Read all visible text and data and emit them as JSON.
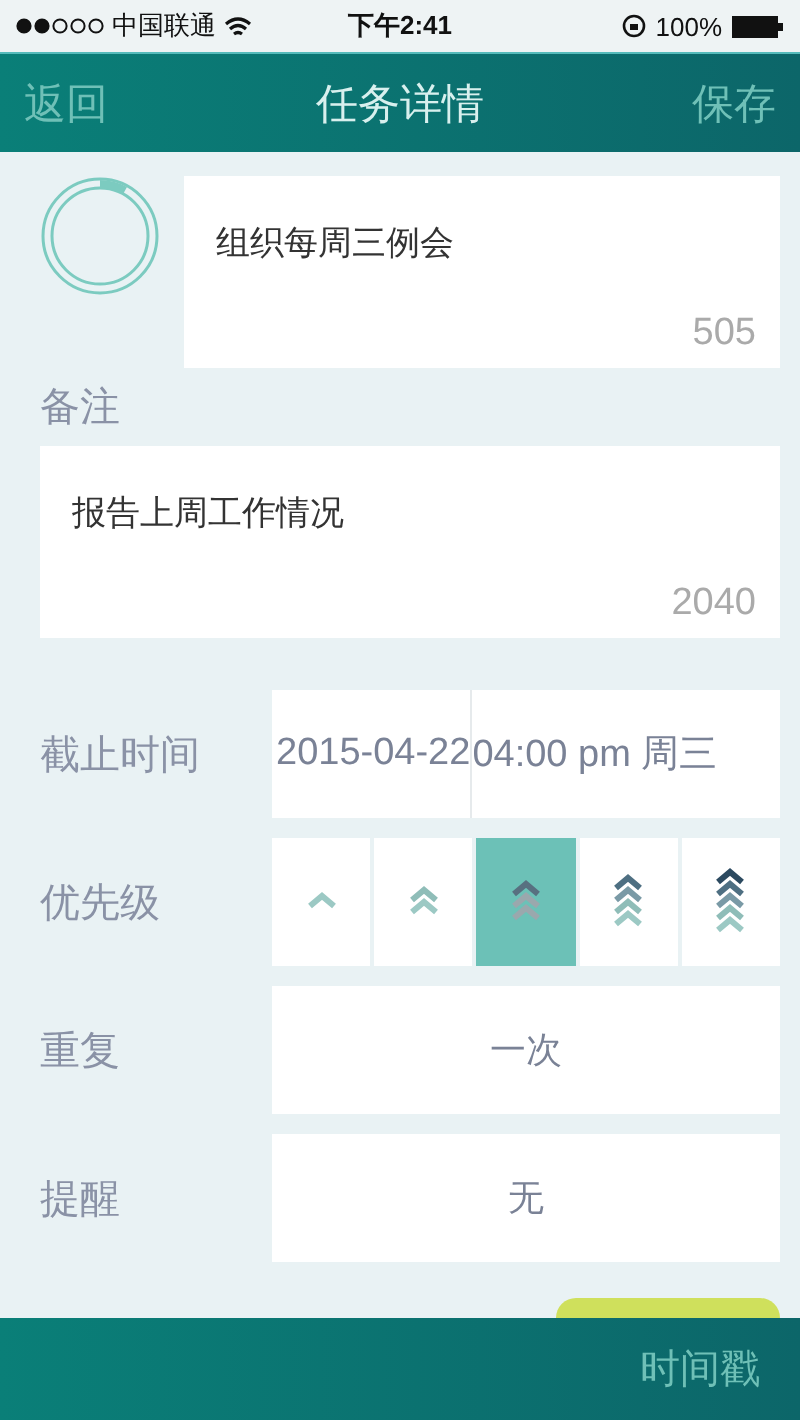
{
  "status_bar": {
    "carrier": "中国联通",
    "time": "下午2:41",
    "battery": "100%"
  },
  "nav": {
    "back": "返回",
    "title": "任务详情",
    "save": "保存"
  },
  "task": {
    "title": "组织每周三例会",
    "count": "505"
  },
  "note": {
    "label": "备注",
    "text": "报告上周工作情况",
    "count": "2040"
  },
  "deadline": {
    "label": "截止时间",
    "date": "2015-04-22",
    "time": "04:00 pm 周三"
  },
  "priority": {
    "label": "优先级",
    "options": [
      {
        "selected": false
      },
      {
        "selected": false
      },
      {
        "selected": true
      },
      {
        "selected": false
      },
      {
        "selected": false
      }
    ]
  },
  "repeat": {
    "label": "重复",
    "value": "一次"
  },
  "reminder": {
    "label": "提醒",
    "value": "无"
  },
  "tab_bar": {
    "right": "时间戳"
  }
}
